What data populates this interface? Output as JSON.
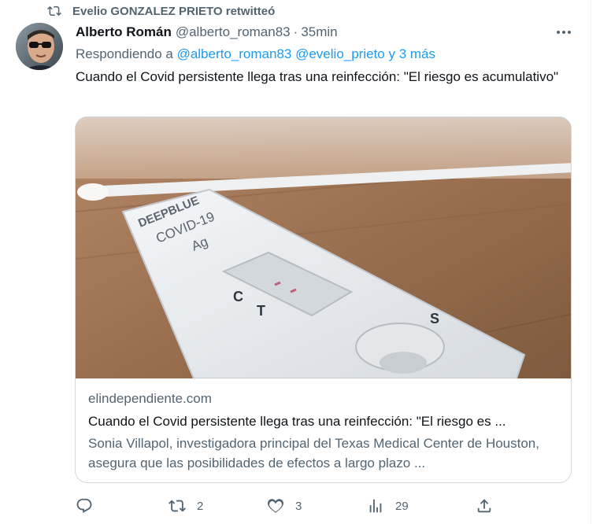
{
  "retweet": {
    "icon": "retweet-icon",
    "text": "Evelio GONZALEZ PRIETO retwitteó"
  },
  "author": {
    "name": "Alberto Román",
    "handle": "@alberto_roman83",
    "separator": "·",
    "time": "35min",
    "avatar_icon": "avatar"
  },
  "reply": {
    "prefix": "Respondiendo a",
    "mention1": "@alberto_roman83",
    "mention2": "@evelio_prieto",
    "suffix": "y 3 más"
  },
  "tweet_text": "Cuando el Covid persistente llega tras una reinfección: \"El riesgo es acumulativo\"",
  "card": {
    "image_labels": {
      "brand": "DEEPBLUE",
      "test_name": "COVID-19",
      "test_type": "Ag",
      "c_mark": "C",
      "t_mark": "T",
      "s_mark": "S"
    },
    "domain": "elindependiente.com",
    "title": "Cuando el Covid persistente llega tras una reinfección: \"El riesgo es ...",
    "description": "Sonia Villapol, investigadora principal del Texas Medical Center de Houston, asegura que las posibilidades de efectos a largo plazo ..."
  },
  "actions": {
    "reply_count": "",
    "retweet_count": "2",
    "like_count": "3",
    "views_count": "29"
  },
  "colors": {
    "link": "#1d9bf0",
    "secondary_text": "#536471",
    "primary_text": "#0f1419",
    "border": "#cfd9de"
  }
}
